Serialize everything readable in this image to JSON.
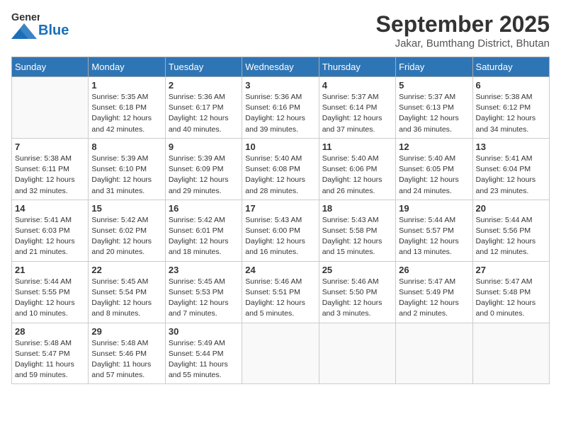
{
  "header": {
    "logo_general": "General",
    "logo_blue": "Blue",
    "month": "September 2025",
    "location": "Jakar, Bumthang District, Bhutan"
  },
  "weekdays": [
    "Sunday",
    "Monday",
    "Tuesday",
    "Wednesday",
    "Thursday",
    "Friday",
    "Saturday"
  ],
  "weeks": [
    [
      {
        "day": "",
        "info": ""
      },
      {
        "day": "1",
        "info": "Sunrise: 5:35 AM\nSunset: 6:18 PM\nDaylight: 12 hours\nand 42 minutes."
      },
      {
        "day": "2",
        "info": "Sunrise: 5:36 AM\nSunset: 6:17 PM\nDaylight: 12 hours\nand 40 minutes."
      },
      {
        "day": "3",
        "info": "Sunrise: 5:36 AM\nSunset: 6:16 PM\nDaylight: 12 hours\nand 39 minutes."
      },
      {
        "day": "4",
        "info": "Sunrise: 5:37 AM\nSunset: 6:14 PM\nDaylight: 12 hours\nand 37 minutes."
      },
      {
        "day": "5",
        "info": "Sunrise: 5:37 AM\nSunset: 6:13 PM\nDaylight: 12 hours\nand 36 minutes."
      },
      {
        "day": "6",
        "info": "Sunrise: 5:38 AM\nSunset: 6:12 PM\nDaylight: 12 hours\nand 34 minutes."
      }
    ],
    [
      {
        "day": "7",
        "info": "Sunrise: 5:38 AM\nSunset: 6:11 PM\nDaylight: 12 hours\nand 32 minutes."
      },
      {
        "day": "8",
        "info": "Sunrise: 5:39 AM\nSunset: 6:10 PM\nDaylight: 12 hours\nand 31 minutes."
      },
      {
        "day": "9",
        "info": "Sunrise: 5:39 AM\nSunset: 6:09 PM\nDaylight: 12 hours\nand 29 minutes."
      },
      {
        "day": "10",
        "info": "Sunrise: 5:40 AM\nSunset: 6:08 PM\nDaylight: 12 hours\nand 28 minutes."
      },
      {
        "day": "11",
        "info": "Sunrise: 5:40 AM\nSunset: 6:06 PM\nDaylight: 12 hours\nand 26 minutes."
      },
      {
        "day": "12",
        "info": "Sunrise: 5:40 AM\nSunset: 6:05 PM\nDaylight: 12 hours\nand 24 minutes."
      },
      {
        "day": "13",
        "info": "Sunrise: 5:41 AM\nSunset: 6:04 PM\nDaylight: 12 hours\nand 23 minutes."
      }
    ],
    [
      {
        "day": "14",
        "info": "Sunrise: 5:41 AM\nSunset: 6:03 PM\nDaylight: 12 hours\nand 21 minutes."
      },
      {
        "day": "15",
        "info": "Sunrise: 5:42 AM\nSunset: 6:02 PM\nDaylight: 12 hours\nand 20 minutes."
      },
      {
        "day": "16",
        "info": "Sunrise: 5:42 AM\nSunset: 6:01 PM\nDaylight: 12 hours\nand 18 minutes."
      },
      {
        "day": "17",
        "info": "Sunrise: 5:43 AM\nSunset: 6:00 PM\nDaylight: 12 hours\nand 16 minutes."
      },
      {
        "day": "18",
        "info": "Sunrise: 5:43 AM\nSunset: 5:58 PM\nDaylight: 12 hours\nand 15 minutes."
      },
      {
        "day": "19",
        "info": "Sunrise: 5:44 AM\nSunset: 5:57 PM\nDaylight: 12 hours\nand 13 minutes."
      },
      {
        "day": "20",
        "info": "Sunrise: 5:44 AM\nSunset: 5:56 PM\nDaylight: 12 hours\nand 12 minutes."
      }
    ],
    [
      {
        "day": "21",
        "info": "Sunrise: 5:44 AM\nSunset: 5:55 PM\nDaylight: 12 hours\nand 10 minutes."
      },
      {
        "day": "22",
        "info": "Sunrise: 5:45 AM\nSunset: 5:54 PM\nDaylight: 12 hours\nand 8 minutes."
      },
      {
        "day": "23",
        "info": "Sunrise: 5:45 AM\nSunset: 5:53 PM\nDaylight: 12 hours\nand 7 minutes."
      },
      {
        "day": "24",
        "info": "Sunrise: 5:46 AM\nSunset: 5:51 PM\nDaylight: 12 hours\nand 5 minutes."
      },
      {
        "day": "25",
        "info": "Sunrise: 5:46 AM\nSunset: 5:50 PM\nDaylight: 12 hours\nand 3 minutes."
      },
      {
        "day": "26",
        "info": "Sunrise: 5:47 AM\nSunset: 5:49 PM\nDaylight: 12 hours\nand 2 minutes."
      },
      {
        "day": "27",
        "info": "Sunrise: 5:47 AM\nSunset: 5:48 PM\nDaylight: 12 hours\nand 0 minutes."
      }
    ],
    [
      {
        "day": "28",
        "info": "Sunrise: 5:48 AM\nSunset: 5:47 PM\nDaylight: 11 hours\nand 59 minutes."
      },
      {
        "day": "29",
        "info": "Sunrise: 5:48 AM\nSunset: 5:46 PM\nDaylight: 11 hours\nand 57 minutes."
      },
      {
        "day": "30",
        "info": "Sunrise: 5:49 AM\nSunset: 5:44 PM\nDaylight: 11 hours\nand 55 minutes."
      },
      {
        "day": "",
        "info": ""
      },
      {
        "day": "",
        "info": ""
      },
      {
        "day": "",
        "info": ""
      },
      {
        "day": "",
        "info": ""
      }
    ]
  ]
}
